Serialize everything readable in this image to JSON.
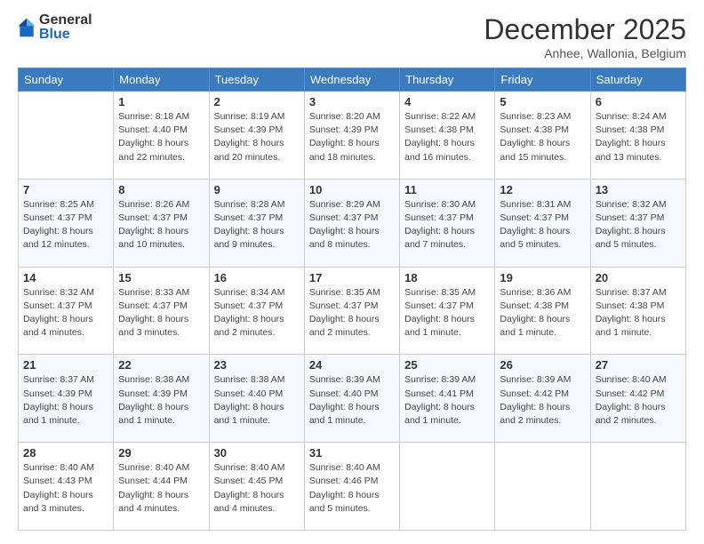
{
  "logo": {
    "general": "General",
    "blue": "Blue"
  },
  "header": {
    "month": "December 2025",
    "location": "Anhee, Wallonia, Belgium"
  },
  "days_of_week": [
    "Sunday",
    "Monday",
    "Tuesday",
    "Wednesday",
    "Thursday",
    "Friday",
    "Saturday"
  ],
  "weeks": [
    [
      {
        "day": "",
        "info": ""
      },
      {
        "day": "1",
        "info": "Sunrise: 8:18 AM\nSunset: 4:40 PM\nDaylight: 8 hours\nand 22 minutes."
      },
      {
        "day": "2",
        "info": "Sunrise: 8:19 AM\nSunset: 4:39 PM\nDaylight: 8 hours\nand 20 minutes."
      },
      {
        "day": "3",
        "info": "Sunrise: 8:20 AM\nSunset: 4:39 PM\nDaylight: 8 hours\nand 18 minutes."
      },
      {
        "day": "4",
        "info": "Sunrise: 8:22 AM\nSunset: 4:38 PM\nDaylight: 8 hours\nand 16 minutes."
      },
      {
        "day": "5",
        "info": "Sunrise: 8:23 AM\nSunset: 4:38 PM\nDaylight: 8 hours\nand 15 minutes."
      },
      {
        "day": "6",
        "info": "Sunrise: 8:24 AM\nSunset: 4:38 PM\nDaylight: 8 hours\nand 13 minutes."
      }
    ],
    [
      {
        "day": "7",
        "info": "Sunrise: 8:25 AM\nSunset: 4:37 PM\nDaylight: 8 hours\nand 12 minutes."
      },
      {
        "day": "8",
        "info": "Sunrise: 8:26 AM\nSunset: 4:37 PM\nDaylight: 8 hours\nand 10 minutes."
      },
      {
        "day": "9",
        "info": "Sunrise: 8:28 AM\nSunset: 4:37 PM\nDaylight: 8 hours\nand 9 minutes."
      },
      {
        "day": "10",
        "info": "Sunrise: 8:29 AM\nSunset: 4:37 PM\nDaylight: 8 hours\nand 8 minutes."
      },
      {
        "day": "11",
        "info": "Sunrise: 8:30 AM\nSunset: 4:37 PM\nDaylight: 8 hours\nand 7 minutes."
      },
      {
        "day": "12",
        "info": "Sunrise: 8:31 AM\nSunset: 4:37 PM\nDaylight: 8 hours\nand 5 minutes."
      },
      {
        "day": "13",
        "info": "Sunrise: 8:32 AM\nSunset: 4:37 PM\nDaylight: 8 hours\nand 5 minutes."
      }
    ],
    [
      {
        "day": "14",
        "info": "Sunrise: 8:32 AM\nSunset: 4:37 PM\nDaylight: 8 hours\nand 4 minutes."
      },
      {
        "day": "15",
        "info": "Sunrise: 8:33 AM\nSunset: 4:37 PM\nDaylight: 8 hours\nand 3 minutes."
      },
      {
        "day": "16",
        "info": "Sunrise: 8:34 AM\nSunset: 4:37 PM\nDaylight: 8 hours\nand 2 minutes."
      },
      {
        "day": "17",
        "info": "Sunrise: 8:35 AM\nSunset: 4:37 PM\nDaylight: 8 hours\nand 2 minutes."
      },
      {
        "day": "18",
        "info": "Sunrise: 8:35 AM\nSunset: 4:37 PM\nDaylight: 8 hours\nand 1 minute."
      },
      {
        "day": "19",
        "info": "Sunrise: 8:36 AM\nSunset: 4:38 PM\nDaylight: 8 hours\nand 1 minute."
      },
      {
        "day": "20",
        "info": "Sunrise: 8:37 AM\nSunset: 4:38 PM\nDaylight: 8 hours\nand 1 minute."
      }
    ],
    [
      {
        "day": "21",
        "info": "Sunrise: 8:37 AM\nSunset: 4:39 PM\nDaylight: 8 hours\nand 1 minute."
      },
      {
        "day": "22",
        "info": "Sunrise: 8:38 AM\nSunset: 4:39 PM\nDaylight: 8 hours\nand 1 minute."
      },
      {
        "day": "23",
        "info": "Sunrise: 8:38 AM\nSunset: 4:40 PM\nDaylight: 8 hours\nand 1 minute."
      },
      {
        "day": "24",
        "info": "Sunrise: 8:39 AM\nSunset: 4:40 PM\nDaylight: 8 hours\nand 1 minute."
      },
      {
        "day": "25",
        "info": "Sunrise: 8:39 AM\nSunset: 4:41 PM\nDaylight: 8 hours\nand 1 minute."
      },
      {
        "day": "26",
        "info": "Sunrise: 8:39 AM\nSunset: 4:42 PM\nDaylight: 8 hours\nand 2 minutes."
      },
      {
        "day": "27",
        "info": "Sunrise: 8:40 AM\nSunset: 4:42 PM\nDaylight: 8 hours\nand 2 minutes."
      }
    ],
    [
      {
        "day": "28",
        "info": "Sunrise: 8:40 AM\nSunset: 4:43 PM\nDaylight: 8 hours\nand 3 minutes."
      },
      {
        "day": "29",
        "info": "Sunrise: 8:40 AM\nSunset: 4:44 PM\nDaylight: 8 hours\nand 4 minutes."
      },
      {
        "day": "30",
        "info": "Sunrise: 8:40 AM\nSunset: 4:45 PM\nDaylight: 8 hours\nand 4 minutes."
      },
      {
        "day": "31",
        "info": "Sunrise: 8:40 AM\nSunset: 4:46 PM\nDaylight: 8 hours\nand 5 minutes."
      },
      {
        "day": "",
        "info": ""
      },
      {
        "day": "",
        "info": ""
      },
      {
        "day": "",
        "info": ""
      }
    ]
  ]
}
